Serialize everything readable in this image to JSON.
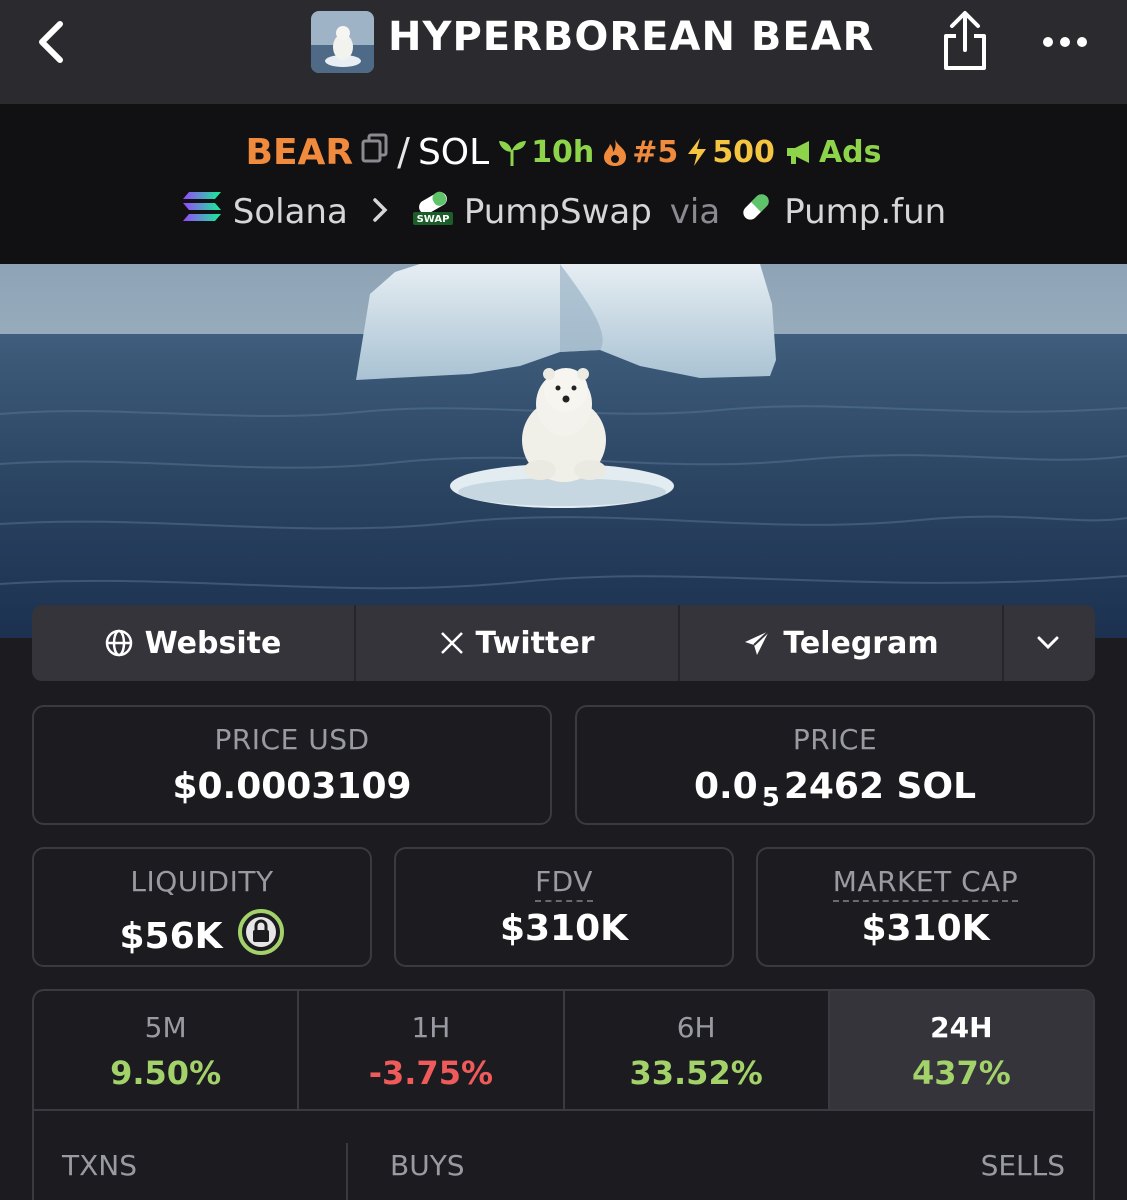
{
  "nav": {
    "title": "HYPERBOREAN BEAR"
  },
  "pair": {
    "base_symbol": "BEAR",
    "separator": "/",
    "quote_symbol": "SOL",
    "age": "10h",
    "rank": "#5",
    "boost": "500",
    "ads": "Ads",
    "chain": "Solana",
    "dex": "PumpSwap",
    "via": "via",
    "launchpad": "Pump.fun"
  },
  "links": {
    "website": "Website",
    "twitter": "Twitter",
    "telegram": "Telegram"
  },
  "stats": {
    "price_usd_label": "PRICE USD",
    "price_usd": "$0.0003109",
    "price_label": "PRICE",
    "price_prefix": "0.0",
    "price_zeros": "5",
    "price_suffix": "2462 SOL",
    "liquidity_label": "LIQUIDITY",
    "liquidity": "$56K",
    "fdv_label": "FDV",
    "fdv": "$310K",
    "mcap_label": "MARKET CAP",
    "mcap": "$310K"
  },
  "changes": [
    {
      "label": "5M",
      "value": "9.50%",
      "trend": "up"
    },
    {
      "label": "1H",
      "value": "-3.75%",
      "trend": "down"
    },
    {
      "label": "6H",
      "value": "33.52%",
      "trend": "up"
    },
    {
      "label": "24H",
      "value": "437%",
      "trend": "up"
    }
  ],
  "txns": {
    "txns_label": "TXNS",
    "buys_label": "BUYS",
    "sells_label": "SELLS"
  },
  "colors": {
    "accent_orange": "#f08a3c",
    "positive": "#a3d26b",
    "negative": "#ef5a5a",
    "background": "#1c1c20"
  }
}
